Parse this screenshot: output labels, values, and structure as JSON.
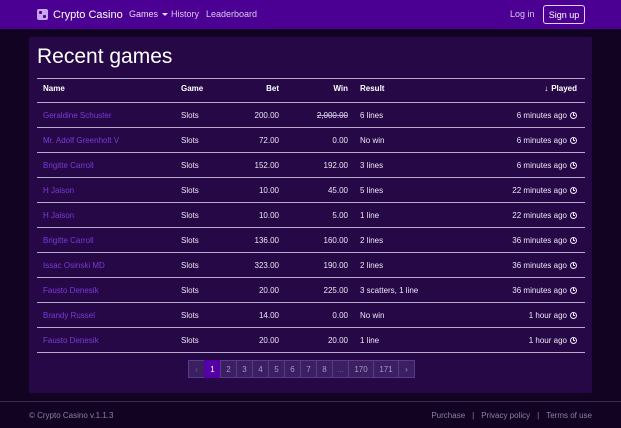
{
  "nav": {
    "brand": "Crypto Casino",
    "brand_icon": "dice-icon",
    "items": [
      "Games",
      "History",
      "Leaderboard"
    ],
    "login": "Log in",
    "signup": "Sign up"
  },
  "page": {
    "title": "Recent games"
  },
  "table": {
    "headers": {
      "name": "Name",
      "game": "Game",
      "bet": "Bet",
      "win": "Win",
      "result": "Result",
      "played": "Played"
    },
    "rows": [
      {
        "name": "Geraldine Schuster",
        "game": "Slots",
        "bet": "200.00",
        "win": "2,000.00",
        "result": "6 lines",
        "played": "6 minutes ago"
      },
      {
        "name": "Mr. Adolf Greenholt V",
        "game": "Slots",
        "bet": "72.00",
        "win": "0.00",
        "result": "No win",
        "played": "6 minutes ago"
      },
      {
        "name": "Brigitte Carroll",
        "game": "Slots",
        "bet": "152.00",
        "win": "192.00",
        "result": "3 lines",
        "played": "6 minutes ago"
      },
      {
        "name": "H Jaison",
        "game": "Slots",
        "bet": "10.00",
        "win": "45.00",
        "result": "5 lines",
        "played": "22 minutes ago"
      },
      {
        "name": "H Jaison",
        "game": "Slots",
        "bet": "10.00",
        "win": "5.00",
        "result": "1 line",
        "played": "22 minutes ago"
      },
      {
        "name": "Brigitte Carroll",
        "game": "Slots",
        "bet": "136.00",
        "win": "160.00",
        "result": "2 lines",
        "played": "36 minutes ago"
      },
      {
        "name": "Issac Osinski MD",
        "game": "Slots",
        "bet": "323.00",
        "win": "190.00",
        "result": "2 lines",
        "played": "36 minutes ago"
      },
      {
        "name": "Fausto Denesik",
        "game": "Slots",
        "bet": "20.00",
        "win": "225.00",
        "result": "3 scatters, 1 line",
        "played": "36 minutes ago"
      },
      {
        "name": "Brandy Russel",
        "game": "Slots",
        "bet": "14.00",
        "win": "0.00",
        "result": "No win",
        "played": "1 hour ago"
      },
      {
        "name": "Fausto Denesik",
        "game": "Slots",
        "bet": "20.00",
        "win": "20.00",
        "result": "1 line",
        "played": "1 hour ago"
      }
    ]
  },
  "pagination": {
    "prev": "‹",
    "pages": [
      "1",
      "2",
      "3",
      "4",
      "5",
      "6",
      "7",
      "8",
      "...",
      "170",
      "171"
    ],
    "active": "1",
    "next": "›"
  },
  "footer": {
    "copyright": "© Crypto Casino v.1.1.3",
    "links": [
      "Purchase",
      "Privacy policy",
      "Terms of use"
    ],
    "separator": "|"
  },
  "colors": {
    "navbar": "#4b0093",
    "background": "#120322",
    "card": "#260847",
    "link": "#7a3ad6",
    "active_page": "#5400a6"
  }
}
